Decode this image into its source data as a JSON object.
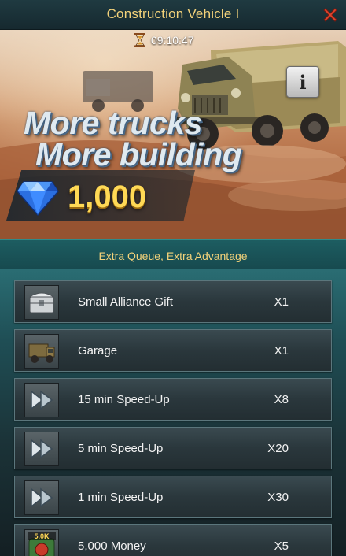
{
  "header": {
    "title": "Construction Vehicle I",
    "close_icon": "close-icon",
    "close_color": "#e0452e"
  },
  "banner": {
    "timer_icon": "hourglass-icon",
    "timer": "09:10:47",
    "info_label": "i",
    "headline_line1": "More trucks",
    "headline_line2": "More building",
    "price_icon": "diamond-gem-icon",
    "price": "1,000"
  },
  "subtitle": "Extra Queue, Extra Advantage",
  "items": [
    {
      "icon": "silver-chest-icon",
      "name": "Small Alliance Gift",
      "qty": "X1"
    },
    {
      "icon": "armored-truck-icon",
      "name": "Garage",
      "qty": "X1"
    },
    {
      "icon": "speed-up-arrows-icon",
      "name": "15 min Speed-Up",
      "qty": "X8"
    },
    {
      "icon": "speed-up-arrows-icon",
      "name": "5 min Speed-Up",
      "qty": "X20"
    },
    {
      "icon": "speed-up-arrows-icon",
      "name": "1 min Speed-Up",
      "qty": "X30"
    },
    {
      "icon": "money-bag-icon",
      "name": "5,000 Money",
      "qty": "X5",
      "badge": "5.0K"
    }
  ],
  "colors": {
    "gold_text": "#f3d27a",
    "price_text": "#ffd955",
    "teal_bar": "#1d5d61"
  }
}
